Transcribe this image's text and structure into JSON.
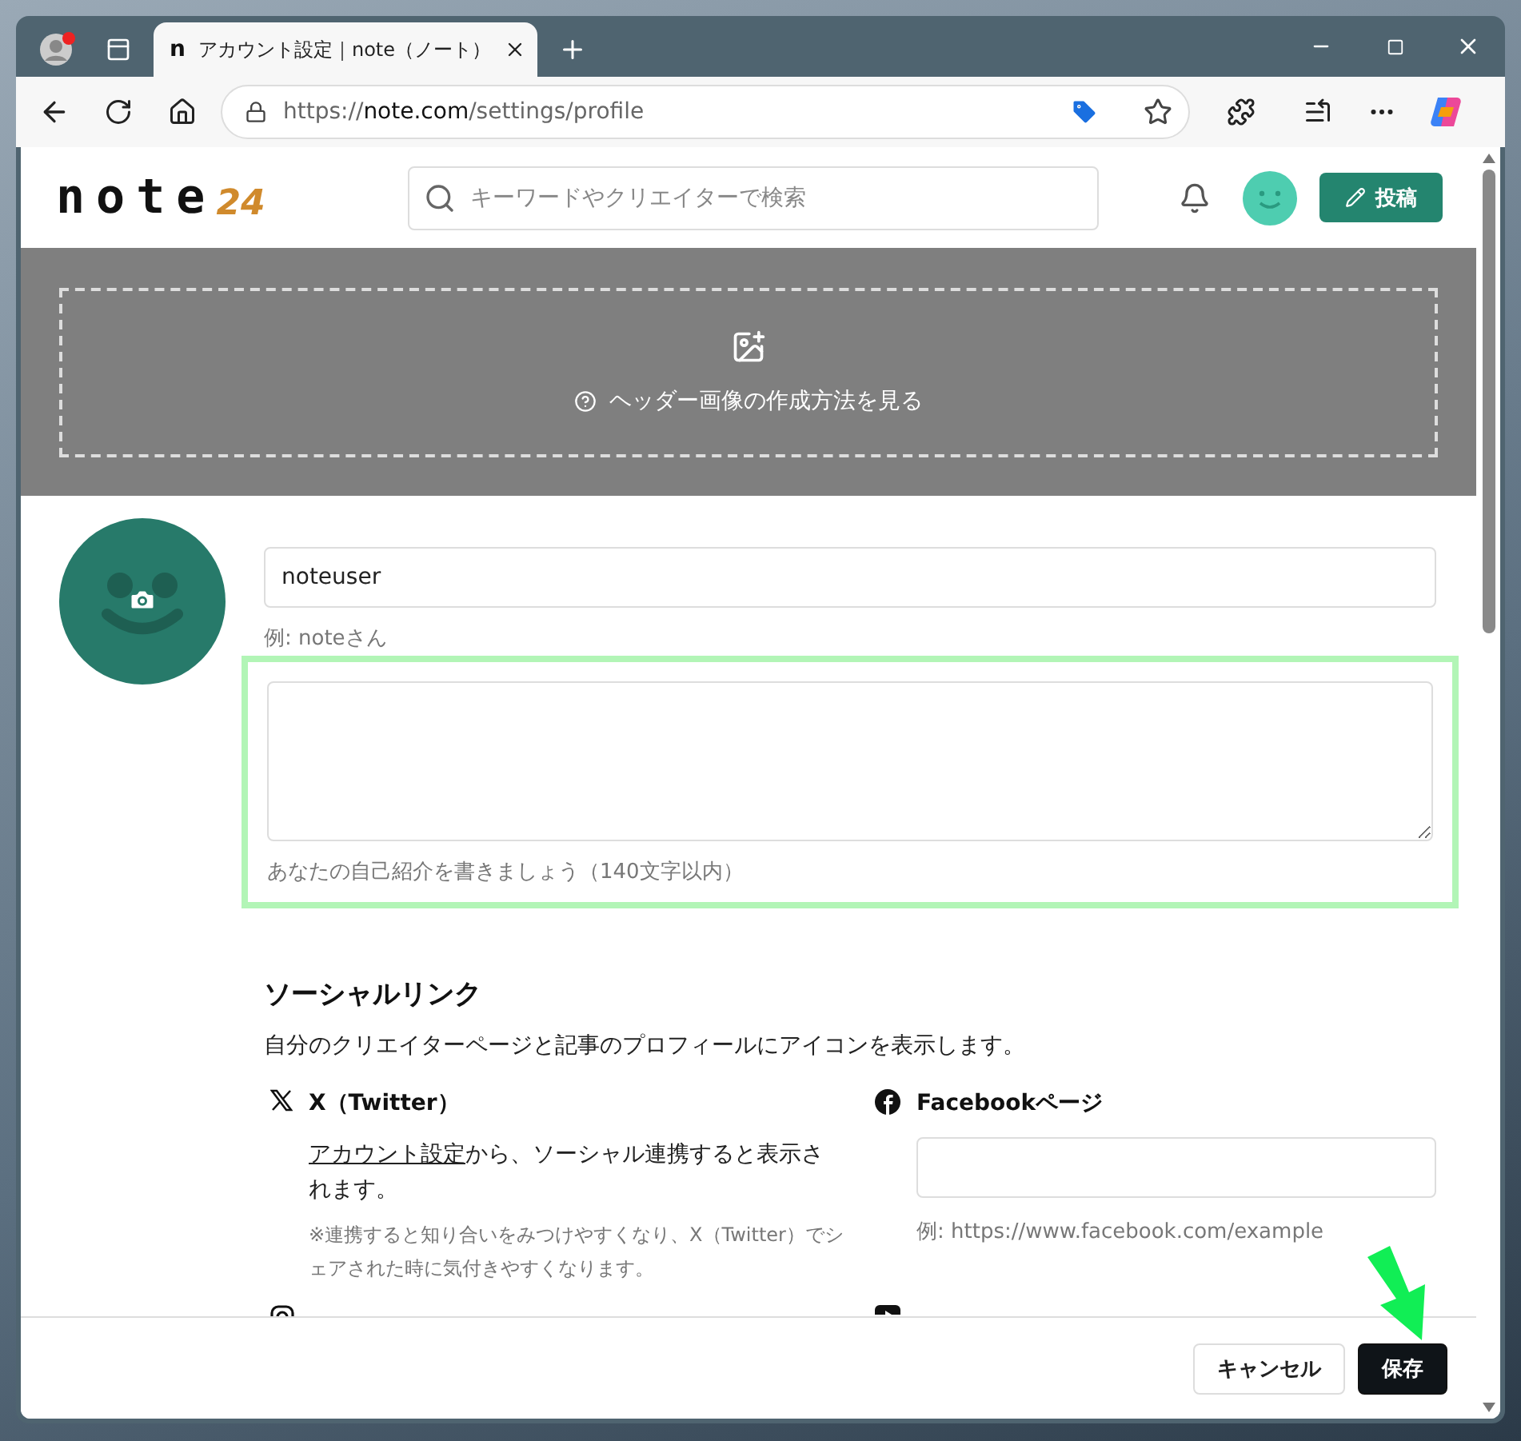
{
  "browser": {
    "tab": {
      "favicon": "n",
      "title": "アカウント設定｜note（ノート）",
      "selected": true
    },
    "address": {
      "scheme": "https://",
      "host": "note.com",
      "path": "/settings/profile"
    }
  },
  "header": {
    "logo": "note",
    "logo_badge": "24",
    "search": {
      "placeholder": "キーワードやクリエイターで検索"
    },
    "post_button": "投稿"
  },
  "cover": {
    "help_link": "ヘッダー画像の作成方法を見る"
  },
  "profile": {
    "name": {
      "value": "noteuser",
      "hint": "例: noteさん"
    },
    "bio": {
      "hint": "あなたの自己紹介を書きましょう（140文字以内）",
      "highlighted": true
    }
  },
  "social": {
    "title": "ソーシャルリンク",
    "description": "自分のクリエイターページと記事のプロフィールにアイコンを表示します。",
    "items": [
      {
        "kind": "twitter",
        "label": "X（Twitter）",
        "link": "アカウント設定",
        "text": "から、ソーシャル連携すると表示されます。",
        "note": "※連携すると知り合いをみつけやすくなり、X（Twitter）でシェアされた時に気付きやすくなります。"
      },
      {
        "kind": "facebook",
        "label": "Facebookページ",
        "hint": "例: https://www.facebook.com/example"
      },
      {
        "kind": "instagram"
      },
      {
        "kind": "youtube"
      }
    ]
  },
  "footer": {
    "cancel": "キャンセル",
    "save": "保存",
    "pointer_arrow": true
  }
}
